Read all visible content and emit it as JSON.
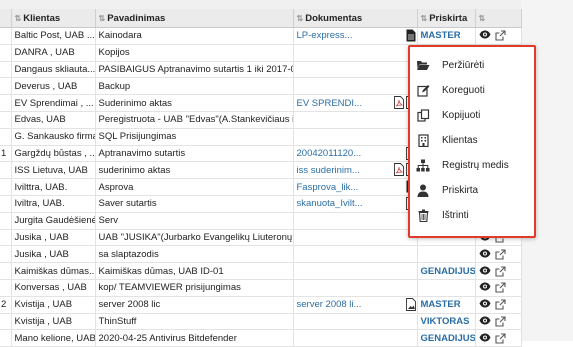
{
  "columns": {
    "klientas": "Klientas",
    "pavadinimas": "Pavadinimas",
    "dokumentas": "Dokumentas",
    "priskirta": "Priskirta"
  },
  "rows": [
    {
      "num": "",
      "klientas": "Baltic Post, UAB ...",
      "pavadinimas": "Kainodara",
      "dokumentas": "LP-express...",
      "priskirta": "MASTER"
    },
    {
      "num": "",
      "klientas": "DANRA , UAB",
      "pavadinimas": "Kopijos",
      "dokumentas": "",
      "priskirta": ""
    },
    {
      "num": "",
      "klientas": "Dangaus skliauta...",
      "pavadinimas": "PASIBAIGUS Aptranavimo sutartis 1 iki 2017-0...",
      "dokumentas": "",
      "priskirta": ""
    },
    {
      "num": "",
      "klientas": "Deverus , UAB",
      "pavadinimas": "Backup",
      "dokumentas": "",
      "priskirta": ""
    },
    {
      "num": "",
      "klientas": "EV Sprendimai , ...",
      "pavadinimas": "Suderinimo aktas",
      "dokumentas": "EV SPRENDI...",
      "priskirta": ""
    },
    {
      "num": "",
      "klientas": "Edvas, UAB",
      "pavadinimas": "Peregistruota - UAB \"Edvas\"(A.Stankevičiaus i...",
      "dokumentas": "",
      "priskirta": ""
    },
    {
      "num": "",
      "klientas": "G. Sankausko firma",
      "pavadinimas": "SQL Prisijungimas",
      "dokumentas": "",
      "priskirta": ""
    },
    {
      "num": "1",
      "klientas": "Gargždų būstas , ...",
      "pavadinimas": "Aptranavimo sutartis",
      "dokumentas": "20042011120...",
      "priskirta": ""
    },
    {
      "num": "",
      "klientas": "ISS Lietuva, UAB",
      "pavadinimas": "suderinimo aktas",
      "dokumentas": "iss suderinim...",
      "priskirta": ""
    },
    {
      "num": "",
      "klientas": "Ivilttra, UAB.",
      "pavadinimas": "Asprova",
      "dokumentas": "Fasprova_lik...",
      "priskirta": ""
    },
    {
      "num": "",
      "klientas": "Iviltra, UAB.",
      "pavadinimas": "Saver sutartis",
      "dokumentas": "skanuota_Ivilt...",
      "priskirta": ""
    },
    {
      "num": "",
      "klientas": "Jurgita Gaudėšienė",
      "pavadinimas": "Serv",
      "dokumentas": "",
      "priskirta": ""
    },
    {
      "num": "",
      "klientas": "Jusika , UAB",
      "pavadinimas": "UAB \"JUSIKA\"(Jurbarko Evangelikų Liuteronų ...",
      "dokumentas": "",
      "priskirta": ""
    },
    {
      "num": "",
      "klientas": "Jusika , UAB",
      "pavadinimas": "sa slaptazodis",
      "dokumentas": "",
      "priskirta": ""
    },
    {
      "num": "",
      "klientas": "Kaimiškas dūmas...",
      "pavadinimas": "Kaimiškas dūmas, UAB ID-01",
      "dokumentas": "",
      "priskirta": "GENADIJUS"
    },
    {
      "num": "",
      "klientas": "Konversas , UAB",
      "pavadinimas": "kop/ TEAMVIEWER prisijungimas",
      "dokumentas": "",
      "priskirta": ""
    },
    {
      "num": "2",
      "klientas": "Kvistija , UAB",
      "pavadinimas": "server 2008 lic",
      "dokumentas": "server 2008 li...",
      "priskirta": "MASTER"
    },
    {
      "num": "",
      "klientas": "Kvistija , UAB",
      "pavadinimas": "ThinStuff",
      "dokumentas": "",
      "priskirta": "VIKTORAS"
    },
    {
      "num": "",
      "klientas": "Mano kelione, UAB",
      "pavadinimas": "2020-04-25 Antivirus Bitdefender",
      "dokumentas": "",
      "priskirta": "GENADIJUS"
    }
  ],
  "menu": {
    "items": [
      {
        "label": "Peržiūrėti",
        "icon": "folder-open-icon"
      },
      {
        "label": "Koreguoti",
        "icon": "edit-icon"
      },
      {
        "label": "Kopijuoti",
        "icon": "copy-icon"
      },
      {
        "label": "Klientas",
        "icon": "building-icon"
      },
      {
        "label": "Registrų medis",
        "icon": "sitemap-icon"
      },
      {
        "label": "Priskirta",
        "icon": "user-icon"
      },
      {
        "label": "Ištrinti",
        "icon": "trash-icon"
      }
    ]
  },
  "colors": {
    "accent": "#2a6ea6",
    "menu_border": "#e23a2a"
  }
}
